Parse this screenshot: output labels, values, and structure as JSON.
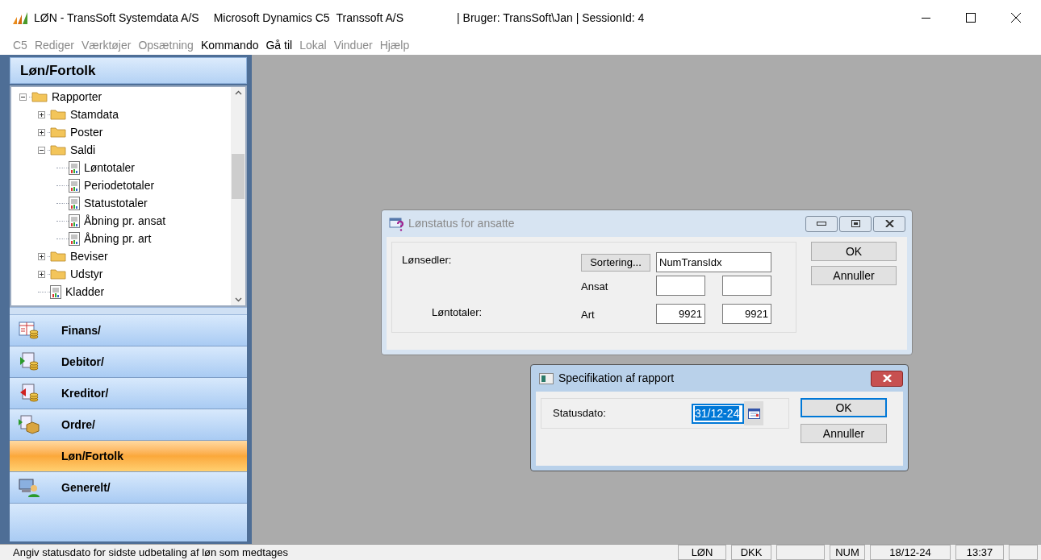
{
  "window": {
    "title": "LØN - TransSoft Systemdata A/S",
    "product": "Microsoft Dynamics C5",
    "company": "Transsoft A/S",
    "session": "| Bruger: TransSoft\\Jan | SessionId: 4"
  },
  "menu": [
    {
      "label": "C5",
      "disabled": true
    },
    {
      "label": "Rediger",
      "disabled": true
    },
    {
      "label": "Værktøjer",
      "disabled": true
    },
    {
      "label": "Opsætning",
      "disabled": true
    },
    {
      "label": "Kommando",
      "disabled": false
    },
    {
      "label": "Gå til",
      "disabled": false
    },
    {
      "label": "Lokal",
      "disabled": true
    },
    {
      "label": "Vinduer",
      "disabled": true
    },
    {
      "label": "Hjælp",
      "disabled": true
    }
  ],
  "sidebar": {
    "title": "Løn/Fortolk",
    "tree": [
      {
        "label": "Rapporter",
        "kind": "folder",
        "expanded": true,
        "children": [
          {
            "label": "Stamdata",
            "kind": "folder",
            "expanded": false
          },
          {
            "label": "Poster",
            "kind": "folder",
            "expanded": false
          },
          {
            "label": "Saldi",
            "kind": "folder",
            "expanded": true,
            "children": [
              {
                "label": "Løntotaler",
                "kind": "report"
              },
              {
                "label": "Periodetotaler",
                "kind": "report"
              },
              {
                "label": "Statustotaler",
                "kind": "report"
              },
              {
                "label": "Åbning pr. ansat",
                "kind": "report"
              },
              {
                "label": "Åbning pr. art",
                "kind": "report"
              }
            ]
          },
          {
            "label": "Beviser",
            "kind": "folder",
            "expanded": false
          },
          {
            "label": "Udstyr",
            "kind": "folder",
            "expanded": false
          },
          {
            "label": "Kladder",
            "kind": "report"
          }
        ]
      }
    ],
    "nav": [
      {
        "label": "Finans/",
        "kind": "finans",
        "selected": false
      },
      {
        "label": "Debitor/",
        "kind": "debitor",
        "selected": false
      },
      {
        "label": "Kreditor/",
        "kind": "kreditor",
        "selected": false
      },
      {
        "label": "Ordre/",
        "kind": "ordre",
        "selected": false
      },
      {
        "label": "Løn/Fortolk",
        "kind": "none",
        "selected": true
      },
      {
        "label": "Generelt/",
        "kind": "generelt",
        "selected": false
      }
    ]
  },
  "dialog_1": {
    "title": "Lønstatus for ansatte",
    "active": false,
    "label_1": "Lønsedler:",
    "sort_button": "Sortering...",
    "sort_value": "NumTransIdx",
    "ansat_label": "Ansat",
    "label_2": "Løntotaler:",
    "art_label": "Art",
    "art_from": "9921",
    "art_to": "9921",
    "ok": "OK",
    "cancel": "Annuller"
  },
  "dialog_2": {
    "title": "Specifikation af rapport",
    "active": true,
    "date_label": "Statusdato:",
    "date_value": "31/12-24",
    "ok": "OK",
    "cancel": "Annuller"
  },
  "status_bar": {
    "message": "Angiv statusdato for sidste udbetaling af løn som medtages",
    "panels": [
      "LØN",
      "DKK",
      "NUM",
      "18/12-24",
      "13:37"
    ]
  }
}
